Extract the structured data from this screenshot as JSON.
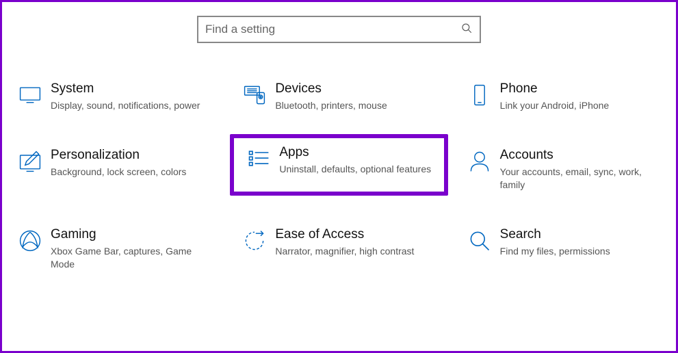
{
  "search": {
    "placeholder": "Find a setting"
  },
  "tiles": {
    "system": {
      "title": "System",
      "desc": "Display, sound, notifications, power"
    },
    "devices": {
      "title": "Devices",
      "desc": "Bluetooth, printers, mouse"
    },
    "phone": {
      "title": "Phone",
      "desc": "Link your Android, iPhone"
    },
    "personalization": {
      "title": "Personalization",
      "desc": "Background, lock screen, colors"
    },
    "apps": {
      "title": "Apps",
      "desc": "Uninstall, defaults, optional features"
    },
    "accounts": {
      "title": "Accounts",
      "desc": "Your accounts, email, sync, work, family"
    },
    "gaming": {
      "title": "Gaming",
      "desc": "Xbox Game Bar, captures, Game Mode"
    },
    "ease": {
      "title": "Ease of Access",
      "desc": "Narrator, magnifier, high contrast"
    },
    "search": {
      "title": "Search",
      "desc": "Find my files, permissions"
    }
  }
}
